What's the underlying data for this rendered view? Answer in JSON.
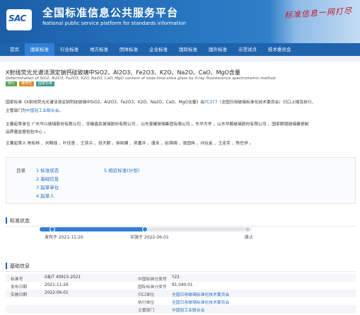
{
  "header": {
    "logo_text": "SAC",
    "title": "全国标准信息公共服务平台",
    "subtitle": "National public service platform  for standards information",
    "slogan": "标准信息一网打尽"
  },
  "nav": {
    "items": [
      {
        "label": "首页",
        "active": false
      },
      {
        "label": "国家标准",
        "active": true
      },
      {
        "label": "行业标准",
        "active": false
      },
      {
        "label": "地方标准",
        "active": false
      },
      {
        "label": "团体标准",
        "active": false
      },
      {
        "label": "企业标准",
        "active": false
      },
      {
        "label": "国际标准",
        "active": false
      },
      {
        "label": "国外标准",
        "active": false
      },
      {
        "label": "示范试点",
        "active": false
      },
      {
        "label": "技术委员会",
        "active": false
      }
    ]
  },
  "standard": {
    "title": "X射线荧光光谱法测定钠钙硅玻璃中SiO2、Al2O3、Fe2O3、K2O、Na2O、CaO、MgO含量",
    "title_en": "Determination of SiO2, Al2O3, Fe2O3, K2O, Na2O, CaO, MgO content of soda-lime-silica glass by X-ray fluorescence spectrometric method",
    "tags": [
      "现行",
      "推荐性",
      "国家标准"
    ],
    "desc_prefix": "国家标准《X射线荧光光谱法测定钠钙硅玻璃中SiO2、Al2O3、Fe2O3、K2O、Na2O、CaO、MgO含量》由",
    "desc_tc": "TC377",
    "desc_middle": "（全国日用玻璃标准化技术委员会）归口上报及执行，",
    "desc_line2_prefix": "主管部门为",
    "desc_dept": "中国轻工业联合会",
    "desc_line2_suffix": "。",
    "drafting_units_line1": "主要起草单位 广东华兴玻璃股份有限公司 、安徽鑫民玻璃股份有限公司 、山东景耀玻璃集团有限公司 、东华大学 、山东华鹏玻璃股份有限公司 、国家眼镜玻璃搪瓷制",
    "drafting_units_line2": "品质量监督检验中心 。",
    "drafters": "主要起草人 陈松林 、刘珮瑶 、叶佳意 、王荻兰 、张大朝 、徐晓健 、吴嘉许 、唐永 、赵锦绸 、张国炜 、孙玩金 、王连军 、陈任伊 。"
  },
  "toc": {
    "label": "目录",
    "items_left": [
      "1 标准状态",
      "2 基础信息",
      "3 起草单位",
      "4 起草人"
    ],
    "items_right": [
      "5 相近标准(计划)"
    ]
  },
  "status_section": {
    "title": "标准状态",
    "progress": 0.5,
    "points": [
      {
        "label": "发布于 2021-11-26",
        "color": "#2f80d6"
      },
      {
        "label": "实施于 2022-06-01",
        "color": "#2f80d6"
      },
      {
        "label": "废止",
        "color": "#c7ccd3"
      }
    ]
  },
  "basic_section": {
    "title": "基础信息",
    "rows": [
      {
        "k1": "标准号",
        "v1": "GB/T 40915-2021",
        "k2": "中国标准分类号",
        "v2": "Y22",
        "v2_link": false
      },
      {
        "k1": "发布日期",
        "v1": "2021-11-26",
        "k2": "国际标准分类号",
        "v2": "81.040.01",
        "v2_link": false
      },
      {
        "k1": "实施日期",
        "v1": "2022-06-01",
        "k2": "归口单位",
        "v2": "全国日用玻璃标准化技术委员会",
        "v2_link": true
      },
      {
        "k1": "",
        "v1": "",
        "k2": "执行单位",
        "v2": "全国日用玻璃标准化技术委员会",
        "v2_link": true
      },
      {
        "k1": "",
        "v1": "",
        "k2": "主管部门",
        "v2": "中国轻工业联合会",
        "v2_link": true
      }
    ]
  }
}
